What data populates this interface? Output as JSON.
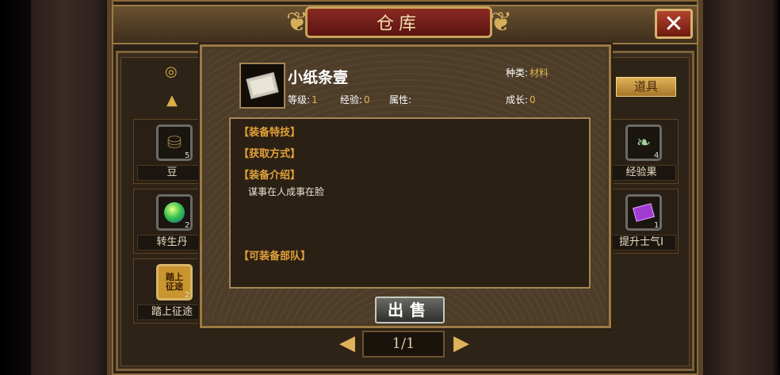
{
  "window": {
    "title": "仓库",
    "close_glyph": "✕"
  },
  "tabs": {
    "props_label": "道具"
  },
  "inventory": {
    "left": [
      {
        "name": "豆",
        "count": "5",
        "icon": "bean-sack-icon"
      },
      {
        "name": "转生丹",
        "count": "2",
        "icon": "rebirth-orb-icon"
      },
      {
        "name": "踏上征途",
        "count": "2",
        "icon": "journey-scroll-icon",
        "icon_text": "踏上\n征途"
      }
    ],
    "right": [
      {
        "name": "经验果",
        "count": "4",
        "icon": "exp-fruit-icon"
      },
      {
        "name": "提升士气Ⅰ",
        "count": "1",
        "icon": "morale-book-icon"
      }
    ]
  },
  "pagination": {
    "current": "1/1",
    "prev_glyph": "◀",
    "next_glyph": "▶"
  },
  "detail": {
    "item_name": "小纸条壹",
    "category_label": "种类:",
    "category_value": "材料",
    "level_label": "等级:",
    "level_value": "1",
    "exp_label": "经验:",
    "exp_value": "0",
    "attr_label": "属性:",
    "growth_label": "成长:",
    "growth_value": "0",
    "sections": {
      "skill": "【装备特技】",
      "obtain": "【获取方式】",
      "intro": "【装备介绍】",
      "troops": "【可装备部队】"
    },
    "intro_text": "谋事在人成事在脸",
    "sell_label": "出售"
  },
  "colors": {
    "accent_gold": "#e1b650",
    "section_orange": "#e1a13a",
    "title_red": "#8a2a22"
  }
}
